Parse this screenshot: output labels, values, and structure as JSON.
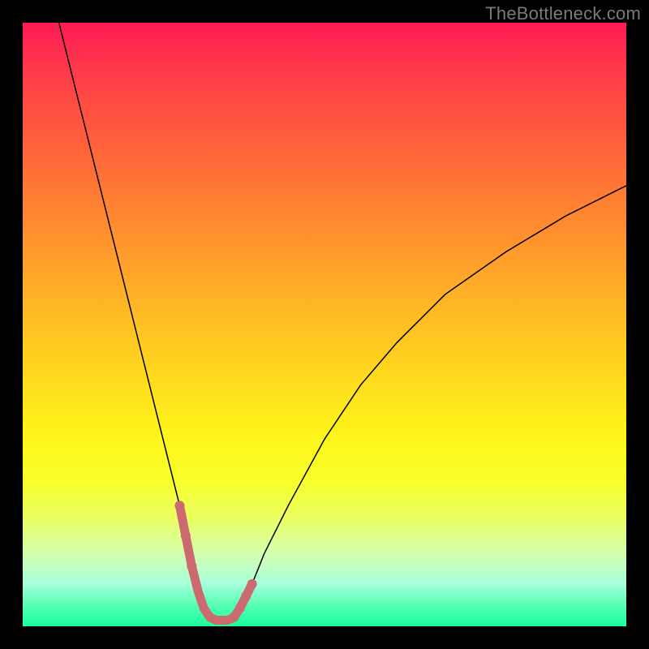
{
  "watermark": "TheBottleneck.com",
  "chart_data": {
    "type": "line",
    "title": "",
    "xlabel": "",
    "ylabel": "",
    "xlim": [
      0,
      100
    ],
    "ylim": [
      0,
      100
    ],
    "curve": {
      "name": "bottleneck-curve",
      "x": [
        6,
        8,
        10,
        12,
        14,
        16,
        18,
        20,
        22,
        24,
        25,
        26,
        27,
        28,
        29,
        30,
        31,
        32,
        33,
        34,
        35,
        36,
        38,
        40,
        44,
        50,
        56,
        62,
        70,
        80,
        90,
        100
      ],
      "y": [
        100,
        92,
        84,
        76,
        68,
        60,
        52,
        44,
        36,
        28,
        24,
        20,
        15,
        10,
        6,
        3,
        1.5,
        1,
        1,
        1,
        1.5,
        3,
        7,
        12,
        20,
        31,
        40,
        47,
        55,
        62,
        68,
        73
      ]
    },
    "highlight_range": {
      "name": "optimum-region",
      "x_start": 26,
      "x_end": 38,
      "points": [
        {
          "x": 26,
          "y": 20
        },
        {
          "x": 27,
          "y": 15
        },
        {
          "x": 28,
          "y": 10
        },
        {
          "x": 29,
          "y": 6
        },
        {
          "x": 30,
          "y": 3
        },
        {
          "x": 31,
          "y": 1.5
        },
        {
          "x": 32,
          "y": 1
        },
        {
          "x": 33,
          "y": 1
        },
        {
          "x": 34,
          "y": 1
        },
        {
          "x": 35,
          "y": 1.5
        },
        {
          "x": 36,
          "y": 3
        },
        {
          "x": 37,
          "y": 5
        },
        {
          "x": 38,
          "y": 7
        }
      ]
    },
    "background_gradient": {
      "top": "#ff1a55",
      "mid": "#fff41a",
      "bottom": "#1aff9e"
    },
    "highlight_color": "#cc6b6f"
  }
}
